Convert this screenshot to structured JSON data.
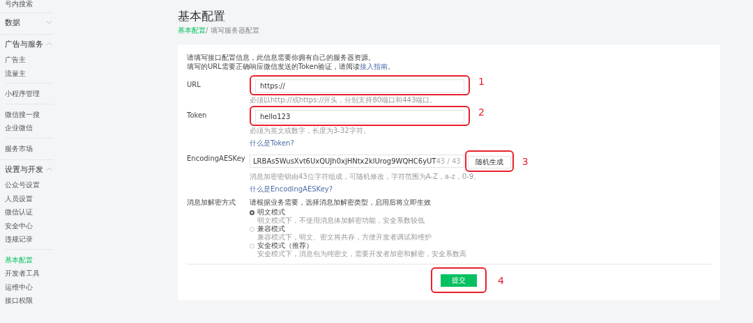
{
  "sidebar": {
    "partial_item": "号内搜索",
    "groups": [
      {
        "label": "数据",
        "expanded": false
      },
      {
        "label": "广告与服务",
        "expanded": true,
        "blocks": [
          [
            {
              "label": "广告主",
              "selected": false
            },
            {
              "label": "流量主",
              "selected": false
            }
          ],
          [
            {
              "label": "小程序管理",
              "selected": false
            }
          ],
          [
            {
              "label": "微信搜一搜",
              "selected": false
            },
            {
              "label": "企业微信",
              "selected": false
            }
          ],
          [
            {
              "label": "服务市场",
              "selected": false
            }
          ]
        ]
      },
      {
        "label": "设置与开发",
        "expanded": true,
        "blocks": [
          [
            {
              "label": "公众号设置",
              "selected": false
            },
            {
              "label": "人员设置",
              "selected": false
            },
            {
              "label": "微信认证",
              "selected": false
            },
            {
              "label": "安全中心",
              "selected": false
            },
            {
              "label": "违规记录",
              "selected": false
            }
          ],
          [
            {
              "label": "基本配置",
              "selected": true
            },
            {
              "label": "开发者工具",
              "selected": false
            },
            {
              "label": "运维中心",
              "selected": false
            },
            {
              "label": "接口权限",
              "selected": false
            }
          ]
        ]
      }
    ]
  },
  "page": {
    "title": "基本配置",
    "breadcrumb": {
      "parent": "基本配置",
      "current": "/ 填写服务器配置"
    }
  },
  "intro": {
    "line_1": "请填写接口配置信息，此信息需要你拥有自己的服务器资源。",
    "line_2": "填写的URL需要正确响应微信发送的Token验证，请阅读",
    "link": "接入指南",
    "after": "。"
  },
  "fields": [
    {
      "kind": "input",
      "label": "URL",
      "value": "https://",
      "hint": "必须以http://或https://开头，分别支持80端口和443端口。",
      "annotation": "1"
    },
    {
      "kind": "input",
      "label": "Token",
      "value": "hello123",
      "hint": "必须为英文或数字，长度为3-32字符。",
      "help_link": "什么是Token?",
      "annotation": "2"
    },
    {
      "kind": "key",
      "label": "EncodingAESKey",
      "value": "LRBAs5WusXvt6UxQUJh0xjHNtx2klUrog9WQHC6yUT",
      "counter": "43 / 43",
      "button": "随机生成",
      "annotation": "3",
      "hint": "消息加密密钥由43位字符组成，可随机修改，字符范围为A-Z，a-z，0-9。",
      "help_link": "什么是EncodingAESKey?"
    },
    {
      "kind": "radio",
      "label": "消息加解密方式",
      "intro": "请根据业务需要，选择消息加解密类型，启用后将立即生效",
      "options": [
        {
          "label": "明文模式",
          "selected": true,
          "desc": "明文模式下，不使用消息体加解密功能，安全系数较低"
        },
        {
          "label": "兼容模式",
          "selected": false,
          "desc": "兼容模式下，明文、密文将共存，方便开发者调试和维护"
        },
        {
          "label": "安全模式（推荐）",
          "selected": false,
          "desc": "安全模式下，消息包为纯密文，需要开发者加密和解密，安全系数高"
        }
      ]
    }
  ],
  "submit": {
    "label": "提交",
    "annotation": "4"
  }
}
